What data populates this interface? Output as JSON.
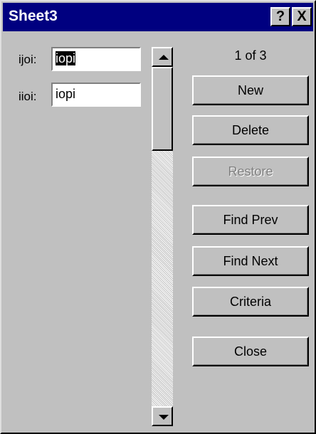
{
  "window": {
    "title": "Sheet3",
    "help_label": "?",
    "close_label": "X"
  },
  "fields": [
    {
      "label": "ijoi:",
      "value": "iopi"
    },
    {
      "label": "iioi:",
      "value": "iopi"
    }
  ],
  "record_counter": "1 of 3",
  "buttons": {
    "new": "New",
    "delete": "Delete",
    "restore": "Restore",
    "find_prev": "Find Prev",
    "find_next": "Find Next",
    "criteria": "Criteria",
    "close": "Close"
  }
}
